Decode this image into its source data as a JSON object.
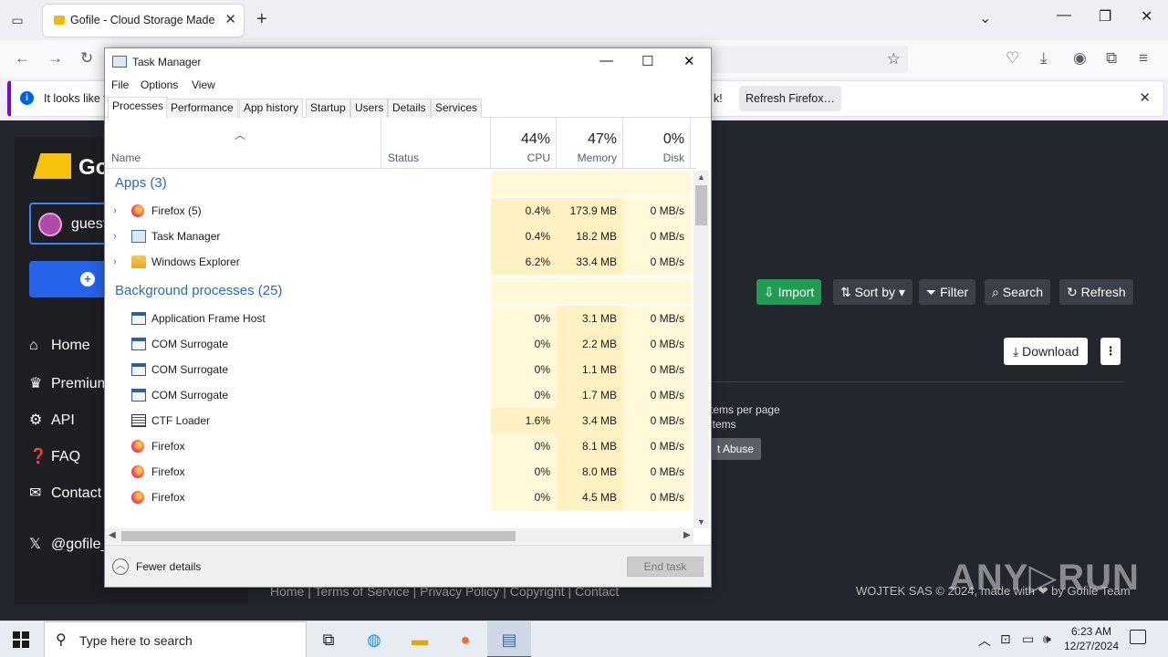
{
  "browser": {
    "tab_title": "Gofile - Cloud Storage Made Si",
    "tab_close": "✕",
    "new_tab": "+",
    "notice": {
      "message": "It looks like y",
      "tail": "k!",
      "button": "Refresh Firefox…"
    }
  },
  "page": {
    "logo_text": "Go",
    "account_name": "guest",
    "nav": [
      {
        "label": "Home",
        "icon": "home-icon"
      },
      {
        "label": "Premium",
        "icon": "crown-icon"
      },
      {
        "label": "API",
        "icon": "gears-icon"
      },
      {
        "label": "FAQ",
        "icon": "question-icon"
      },
      {
        "label": "Contact",
        "icon": "envelope-icon"
      },
      {
        "label": "@gofile_",
        "icon": "x-logo-icon"
      }
    ],
    "toolbar": {
      "import": "Import",
      "sort_by": "Sort by",
      "filter": "Filter",
      "search": "Search",
      "refresh": "Refresh"
    },
    "download": "Download",
    "items_per_page": "tems per page",
    "items": "items",
    "report_abuse": "t Abuse",
    "footer_links": "Home  |  Terms of Service  |  Privacy Policy  |  Copyright  |  Contact",
    "footer_copy": "WOJTEK SAS © 2024, made with ❤ by Gofile Team",
    "watermark": "ANY▷RUN"
  },
  "task_manager": {
    "title": "Task Manager",
    "menu": [
      "File",
      "Options",
      "View"
    ],
    "tabs": [
      "Processes",
      "Performance",
      "App history",
      "Startup",
      "Users",
      "Details",
      "Services"
    ],
    "active_tab": "Processes",
    "columns": {
      "name": "Name",
      "status": "Status",
      "cpu": {
        "label": "CPU",
        "pct": "44%"
      },
      "memory": {
        "label": "Memory",
        "pct": "47%"
      },
      "disk": {
        "label": "Disk",
        "pct": "0%"
      }
    },
    "groups": {
      "apps": "Apps (3)",
      "background": "Background processes (25)"
    },
    "apps": [
      {
        "name": "Firefox (5)",
        "icon": "firefox-icon",
        "cpu": "0.4%",
        "memory": "173.9 MB",
        "disk": "0 MB/s"
      },
      {
        "name": "Task Manager",
        "icon": "task-manager-icon",
        "cpu": "0.4%",
        "memory": "18.2 MB",
        "disk": "0 MB/s"
      },
      {
        "name": "Windows Explorer",
        "icon": "folder-icon",
        "cpu": "6.2%",
        "memory": "33.4 MB",
        "disk": "0 MB/s"
      }
    ],
    "background": [
      {
        "name": "Application Frame Host",
        "icon": "window-icon",
        "cpu": "0%",
        "memory": "3.1 MB",
        "disk": "0 MB/s"
      },
      {
        "name": "COM Surrogate",
        "icon": "window-icon",
        "cpu": "0%",
        "memory": "2.2 MB",
        "disk": "0 MB/s"
      },
      {
        "name": "COM Surrogate",
        "icon": "window-icon",
        "cpu": "0%",
        "memory": "1.1 MB",
        "disk": "0 MB/s"
      },
      {
        "name": "COM Surrogate",
        "icon": "window-icon",
        "cpu": "0%",
        "memory": "1.7 MB",
        "disk": "0 MB/s"
      },
      {
        "name": "CTF Loader",
        "icon": "ctf-icon",
        "cpu": "1.6%",
        "memory": "3.4 MB",
        "disk": "0 MB/s"
      },
      {
        "name": "Firefox",
        "icon": "firefox-icon",
        "cpu": "0%",
        "memory": "8.1 MB",
        "disk": "0 MB/s"
      },
      {
        "name": "Firefox",
        "icon": "firefox-icon",
        "cpu": "0%",
        "memory": "8.0 MB",
        "disk": "0 MB/s"
      },
      {
        "name": "Firefox",
        "icon": "firefox-icon",
        "cpu": "0%",
        "memory": "4.5 MB",
        "disk": "0 MB/s"
      }
    ],
    "fewer_details": "Fewer details",
    "end_task": "End task",
    "heat_colors": {
      "light": "#fff8d9",
      "medium": "#fff1c1"
    }
  },
  "taskbar": {
    "search_placeholder": "Type here to search",
    "time": "6:23 AM",
    "date": "12/27/2024"
  }
}
